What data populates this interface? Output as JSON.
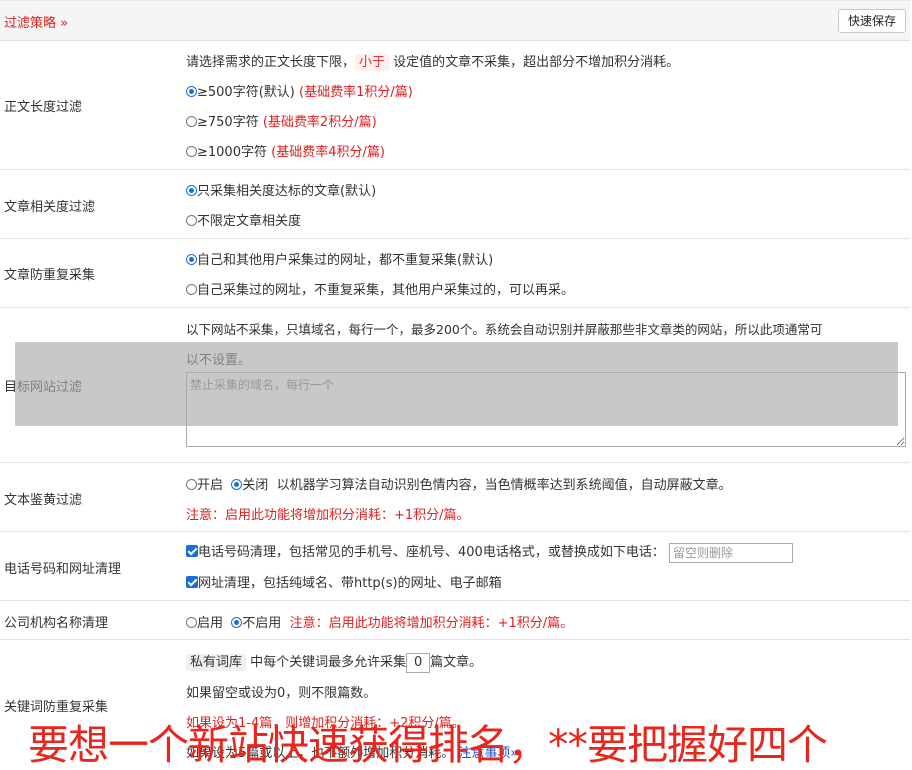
{
  "header": {
    "title": "过滤策略 »",
    "save_label": "快速保存"
  },
  "length_filter": {
    "label": "正文长度过滤",
    "desc_pre": "请选择需求的正文长度下限，",
    "desc_tag": "小于",
    "desc_post": "设定值的文章不采集，超出部分不增加积分消耗。",
    "options": [
      {
        "text": "≥500字符(默认)",
        "note": "(基础费率1积分/篇)",
        "selected": true
      },
      {
        "text": "≥750字符",
        "note": "(基础费率2积分/篇)",
        "selected": false
      },
      {
        "text": "≥1000字符",
        "note": "(基础费率4积分/篇)",
        "selected": false
      }
    ]
  },
  "relevance_filter": {
    "label": "文章相关度过滤",
    "options": [
      {
        "text": "只采集相关度达标的文章(默认)",
        "selected": true
      },
      {
        "text": "不限定文章相关度",
        "selected": false
      }
    ]
  },
  "dup_filter": {
    "label": "文章防重复采集",
    "options": [
      {
        "text": "自己和其他用户采集过的网址，都不重复采集(默认)",
        "selected": true
      },
      {
        "text": "自己采集过的网址，不重复采集，其他用户采集过的，可以再采。",
        "selected": false
      }
    ]
  },
  "site_filter": {
    "label": "目标网站过滤",
    "desc_line1": "以下网站不采集，只填域名，每行一个，最多200个。系统会自动识别并屏蔽那些非文章类的网站，所以此项通常可",
    "desc_line2": "以不设置。",
    "placeholder": "禁止采集的域名，每行一个"
  },
  "porn_filter": {
    "label": "文本鉴黄过滤",
    "on_label": "开启",
    "off_label": "关闭",
    "desc": "以机器学习算法自动识别色情内容，当色情概率达到系统阈值，自动屏蔽文章。",
    "note": "注意：启用此功能将增加积分消耗：+1积分/篇。"
  },
  "phone_clean": {
    "label": "电话号码和网址清理",
    "phone_text": "电话号码清理，包括常见的手机号、座机号、400电话格式，或替换成如下电话：",
    "phone_placeholder": "留空则删除",
    "url_text": "网址清理，包括纯域名、带http(s)的网址、电子邮箱"
  },
  "company_clean": {
    "label": "公司机构名称清理",
    "on_label": "启用",
    "off_label": "不启用",
    "note": "注意：启用此功能将增加积分消耗：+1积分/篇。"
  },
  "keyword_dup": {
    "label": "关键词防重复采集",
    "tag": "私有词库",
    "line1_mid": "中每个关键词最多允许采集",
    "count": "0",
    "line1_post": "篇文章。",
    "line2": "如果留空或设为0，则不限篇数。",
    "line3": "如果设为1-4篇，则增加积分消耗：+2积分/篇。",
    "line4_pre": "如果设为5篇或以上，也不额外增加积分消耗。",
    "line4_link": "注意事项»"
  },
  "banner": {
    "text": "要想一个新站快速获得排名，**要把握好四个"
  },
  "colors": {
    "accent_red": "#e02020",
    "radio_blue": "#1a6fd6"
  }
}
